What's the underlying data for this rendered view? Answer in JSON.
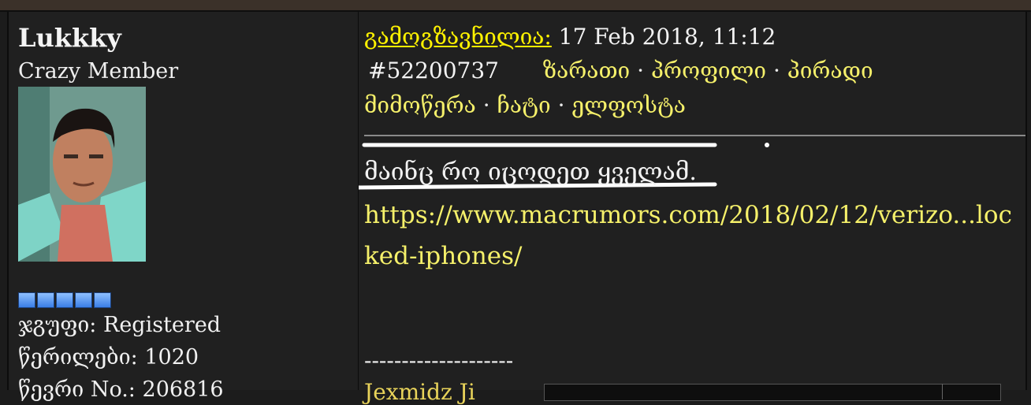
{
  "user": {
    "name": "Lukkky",
    "rank": "Crazy Member",
    "pips": 5,
    "group_label": "ჯგუფი:",
    "group_value": "Registered",
    "posts_label": "წერილები:",
    "posts_value": "1020",
    "member_label": "წევრი No.:",
    "member_value": "206816"
  },
  "post": {
    "posted_label": "გამოგზავნილია:",
    "posted_date": "17 Feb 2018, 11:12",
    "number": "#52200737",
    "links": [
      "ზარათი",
      "პროფილი",
      "პირადი მიმოწერა",
      "ჩატი",
      "ელფოსტა"
    ],
    "links_line2": [
      "პირადი",
      "მიმოწერა",
      "ჩატი",
      "ელფოსტა"
    ],
    "separator": "·",
    "message": "მაინც რო იცოდეთ ყველამ.",
    "url": "https://www.macrumors.com/2018/02/12/verizo...locked-iphones/",
    "signature_dashes": "--------------------",
    "signature_text": "Jexmidz Ji"
  },
  "colors": {
    "link": "#f5f06a",
    "label_yellow": "#fff200",
    "background": "#202020"
  }
}
